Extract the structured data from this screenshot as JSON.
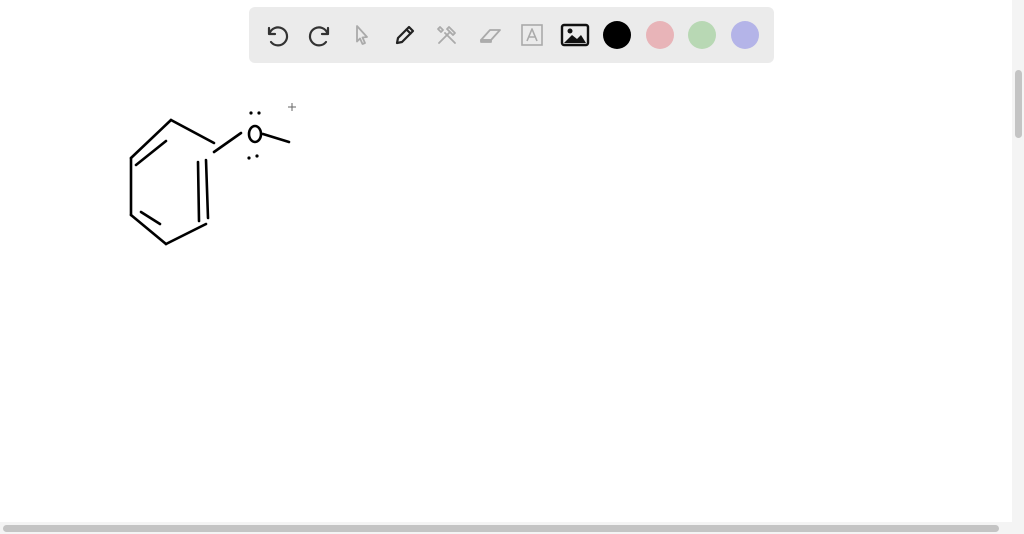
{
  "toolbar": {
    "tools": [
      "undo-icon",
      "redo-icon",
      "select-pointer-icon",
      "pen-icon",
      "tools-icon",
      "eraser-icon",
      "text-icon",
      "image-icon"
    ],
    "colors": {
      "black": "#000000",
      "red": "#e8b4b8",
      "green": "#b8d8b4",
      "blue": "#b4b4e8"
    },
    "selected_color": "black"
  },
  "canvas": {
    "background": "#ffffff",
    "stroke_color": "#000000"
  }
}
